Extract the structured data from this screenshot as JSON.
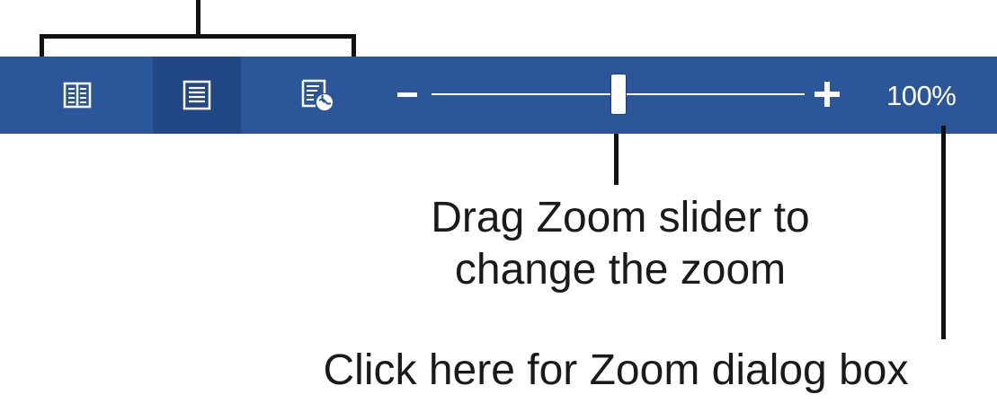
{
  "status_bar": {
    "background": "#2b579a",
    "view_buttons": [
      {
        "name": "read-mode-view",
        "icon": "open-book-icon",
        "active": false
      },
      {
        "name": "print-layout-view",
        "icon": "page-lines-icon",
        "active": true
      },
      {
        "name": "web-layout-view",
        "icon": "page-globe-icon",
        "active": false
      }
    ],
    "zoom": {
      "minus_icon": "minus-icon",
      "plus_icon": "plus-icon",
      "slider_position": 0.5,
      "percent_label": "100%"
    }
  },
  "annotations": {
    "slider_caption_line1": "Drag Zoom slider to",
    "slider_caption_line2": "change the zoom",
    "dialog_caption": "Click here for Zoom dialog box"
  }
}
